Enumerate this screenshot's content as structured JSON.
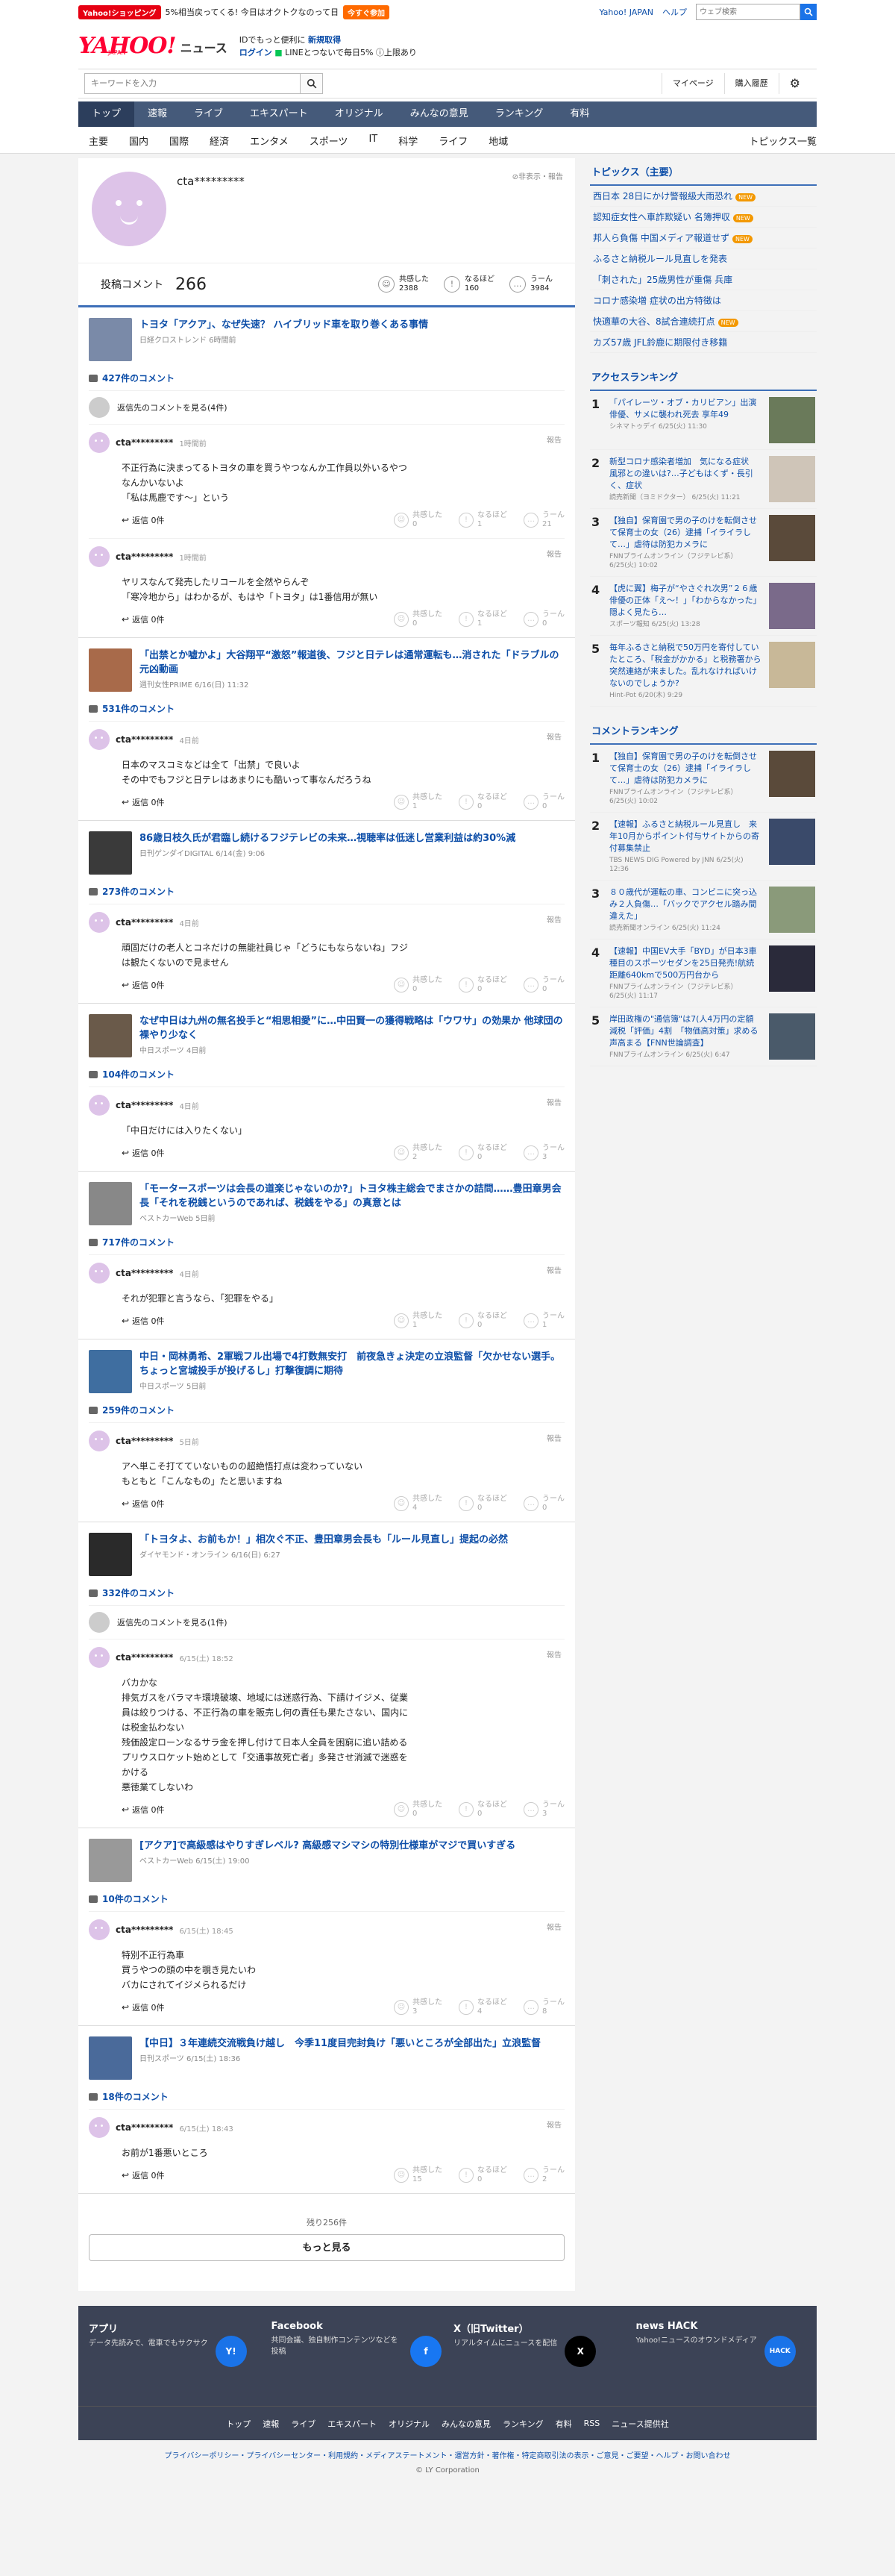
{
  "header": {
    "shop_tag": "Yahoo!ショッピング",
    "shop_promo": "5%相当戻ってくる! 今日はオクトクなのって日",
    "shop_btn": "今すぐ参加",
    "yahoo_japan": "Yahoo! JAPAN",
    "help": "ヘルプ",
    "web_search_placeholder": "ウェブ検索",
    "logo_yahoo": "YAHOO!",
    "logo_japan": "JAPAN",
    "logo_news": "ニュース",
    "promo_line1_a": "IDでもっと便利に",
    "promo_line1_b": "新規取得",
    "promo_line2_a": "ログイン",
    "promo_line2_b": "LINEとつないで毎日5%",
    "promo_line2_c": "上限あり",
    "news_search_placeholder": "キーワードを入力",
    "mypage": "マイページ",
    "purchase": "購入履歴"
  },
  "gnav": [
    "トップ",
    "速報",
    "ライブ",
    "エキスパート",
    "オリジナル",
    "みんなの意見",
    "ランキング",
    "有料"
  ],
  "snav": {
    "items": [
      "主要",
      "国内",
      "国際",
      "経済",
      "エンタメ",
      "スポーツ",
      "IT",
      "科学",
      "ライフ",
      "地域"
    ],
    "all": "トピックス一覧"
  },
  "profile": {
    "name": "cta*********",
    "privacy": "非表示・報告",
    "comments_label": "投稿コメント",
    "comments_count": "266",
    "reactions": [
      {
        "label": "共感した",
        "count": "2388",
        "icon": "☺"
      },
      {
        "label": "なるほど",
        "count": "160",
        "icon": "!"
      },
      {
        "label": "うーん",
        "count": "3984",
        "icon": "…"
      }
    ]
  },
  "articles": [
    {
      "title": "トヨタ「アクア」、なぜ失速？ ハイブリッド車を取り巻くある事情",
      "source": "日経クロストレンド 6時間前",
      "thumb": "#7a8aa8",
      "count": "427件のコメント",
      "reply_note": "返信先のコメントを見る(4件)",
      "comments": [
        {
          "user": "cta*********",
          "time": "1時間前",
          "text": "不正行為に決まってるトヨタの車を買うやつなんか工作員以外いるやつなんかいないよ\n「私は馬鹿です～」という",
          "votes": [
            "0",
            "1",
            "21"
          ]
        },
        {
          "user": "cta*********",
          "time": "1時間前",
          "text": "ヤリスなんて発売したリコールを全然やらんぞ\n「寒冷地から」はわかるが、もはや「トヨタ」は1番信用が無い",
          "votes": [
            "0",
            "1",
            "0"
          ]
        }
      ]
    },
    {
      "title": "「出禁とか嘘かよ」大谷翔平“激怒”報道後、フジと日テレは通常運転も…消された「ドラブルの元凶動画",
      "source": "週刊女性PRIME 6/16(日) 11:32",
      "thumb": "#a86a4a",
      "count": "531件のコメント",
      "reply_note": "",
      "comments": [
        {
          "user": "cta*********",
          "time": "4日前",
          "text": "日本のマスコミなどは全て「出禁」で良いよ\nその中でもフジと日テレはあまりにも酷いって事なんだろうね",
          "votes": [
            "1",
            "0",
            "0"
          ]
        }
      ]
    },
    {
      "title": "86歳日枝久氏が君臨し続けるフジテレビの未来…視聴率は低迷し営業利益は約30%減",
      "source": "日刊ゲンダイDIGITAL 6/14(金) 9:06",
      "thumb": "#3a3a3a",
      "count": "273件のコメント",
      "reply_note": "",
      "comments": [
        {
          "user": "cta*********",
          "time": "4日前",
          "text": "頑固だけの老人とコネだけの無能社員じゃ「どうにもならないね」フジは観たくないので見ません",
          "votes": [
            "0",
            "0",
            "0"
          ]
        }
      ]
    },
    {
      "title": "なぜ中日は九州の無名投手と“相思相愛”に…中田賢一の獲得戦略は「ウワサ」の効果か 他球団の裸やり少なく",
      "source": "中日スポーツ 4日前",
      "thumb": "#6a5a4a",
      "count": "104件のコメント",
      "reply_note": "",
      "comments": [
        {
          "user": "cta*********",
          "time": "4日前",
          "text": "「中日だけには入りたくない」",
          "votes": [
            "2",
            "0",
            "3"
          ]
        }
      ]
    },
    {
      "title": "「モータースポーツは会長の道楽じゃないのか?」トヨタ株主総会でまさかの詰問……豊田章男会長「それを税銭というのであれば、税銭をやる」の真意とは",
      "source": "ベストカーWeb 5日前",
      "thumb": "#888",
      "count": "717件のコメント",
      "reply_note": "",
      "comments": [
        {
          "user": "cta*********",
          "time": "4日前",
          "text": "それが犯罪と言うなら、「犯罪をやる」",
          "votes": [
            "1",
            "0",
            "1"
          ]
        }
      ]
    },
    {
      "title": "中日・岡林勇希、2軍戦フル出場で4打数無安打　前夜急きょ決定の立浪監督「欠かせない選手。ちょっと宮城投手が投げるし」打撃復調に期待",
      "source": "中日スポーツ 5日前",
      "thumb": "#3f6ea0",
      "count": "259件のコメント",
      "reply_note": "",
      "comments": [
        {
          "user": "cta*********",
          "time": "5日前",
          "text": "アヘ単こそ打てていないものの超絶悟打点は変わっていない\nもともと「こんなもの」たと思いますね",
          "votes": [
            "4",
            "0",
            "0"
          ]
        }
      ]
    },
    {
      "title": "「トヨタよ、お前もか！」相次ぐ不正、豊田章男会長も「ルール見直し」提起の必然",
      "source": "ダイヤモンド・オンライン 6/16(日) 6:27",
      "thumb": "#2a2a2a",
      "count": "332件のコメント",
      "reply_note": "返信先のコメントを見る(1件)",
      "comments": [
        {
          "user": "cta*********",
          "time": "6/15(土) 18:52",
          "text": "バカかな\n排気ガスをバラマキ環境破壊、地域には迷惑行為、下請けイジメ、従業員は絞りつける、不正行為の車を販売し何の責任も果たさない、国内には税金払わない\n残価設定ローンなるサラ金を押し付けて日本人全員を困窮に追い詰める\nプリウスロケット始めとして「交通事故死亡者」多発させ消滅で迷惑をかける\n悪徳業てしないわ",
          "votes": [
            "0",
            "0",
            "3"
          ]
        }
      ]
    },
    {
      "title": "[アクア]で高級感はやりすぎレベル? 高級感マシマシの特別仕様車がマジで買いすぎる",
      "source": "ベストカーWeb 6/15(土) 19:00",
      "thumb": "#999",
      "count": "10件のコメント",
      "reply_note": "",
      "comments": [
        {
          "user": "cta*********",
          "time": "6/15(土) 18:45",
          "text": "特別不正行為車\n買うやつの頭の中を覗き見たいわ\nバカにされてイジメられるだけ",
          "votes": [
            "3",
            "4",
            "8"
          ]
        }
      ]
    },
    {
      "title": "【中日】３年連続交流戦負け越し　今季11度目完封負け「悪いところが全部出た」立浪監督",
      "source": "日刊スポーツ 6/15(土) 18:36",
      "thumb": "#4a6a9a",
      "count": "18件のコメント",
      "reply_note": "",
      "comments": [
        {
          "user": "cta*********",
          "time": "6/15(土) 18:43",
          "text": "お前が1番悪いところ",
          "votes": [
            "15",
            "0",
            "2"
          ]
        }
      ]
    }
  ],
  "comment_ui": {
    "report": "報告",
    "reply": "返信 0件",
    "vote_labels": [
      "共感した",
      "なるほど",
      "うーん"
    ]
  },
  "more": {
    "remain": "残り256件",
    "button": "もっと見る"
  },
  "topics": {
    "title": "トピックス（主要）",
    "items": [
      {
        "text": "西日本 28日にかけ警報級大雨恐れ",
        "new": true
      },
      {
        "text": "認知症女性へ車詐欺疑い 名簿押収",
        "new": true
      },
      {
        "text": "邦人ら負傷 中国メディア報道せず",
        "new": true
      },
      {
        "text": "ふるさと納税ルール見直しを発表",
        "new": false
      },
      {
        "text": "「刺された」25歳男性が重傷 兵庫",
        "new": false
      },
      {
        "text": "コロナ感染増 症状の出方特徴は",
        "new": false
      },
      {
        "text": "快適華の大谷、8試合連続打点",
        "new": true
      },
      {
        "text": "カズ57歳 JFL鈴鹿に期限付き移籍",
        "new": false
      }
    ],
    "new_label": "NEW"
  },
  "access_ranking": {
    "title": "アクセスランキング",
    "items": [
      {
        "n": "1",
        "t": "「パイレーツ・オブ・カリビアン」出演俳優、サメに襲われ死去 享年49",
        "s": "シネマトゥデイ 6/25(火) 11:30",
        "c": "#6a7a5a"
      },
      {
        "n": "2",
        "t": "新型コロナ感染者増加　気になる症状　風邪との違いは?…子どもはくず・長引く、症状",
        "s": "読売新聞（ヨミドクター） 6/25(火) 11:21",
        "c": "#cfc5b8"
      },
      {
        "n": "3",
        "t": "【独自】保育園で男の子のけを転倒させて保育士の女（26）逮捕「イライラして…」虐待は防犯カメラに",
        "s": "FNNプライムオンライン（フジテレビ系） 6/25(火) 10:02",
        "c": "#5a4a3a"
      },
      {
        "n": "4",
        "t": "【虎に翼】梅子が“やさぐれ次男”２６歳俳優の正体「え～！」「わからなかった」隠よく見たら…",
        "s": "スポーツ報知 6/25(火) 13:28",
        "c": "#7a6a8a"
      },
      {
        "n": "5",
        "t": "毎年ふるさと納税で50万円を寄付していたところ、「税金がかかる」と税務署から突然連絡が来ました。乱れなければいけないのでしょうか?",
        "s": "Hint-Pot 6/20(木) 9:29",
        "c": "#c8b898"
      }
    ]
  },
  "comment_ranking": {
    "title": "コメントランキング",
    "items": [
      {
        "n": "1",
        "t": "【独自】保育園で男の子のけを転倒させて保育士の女（26）逮捕「イライラして…」虐待は防犯カメラに",
        "s": "FNNプライムオンライン（フジテレビ系） 6/25(火) 10:02",
        "c": "#5a4a3a"
      },
      {
        "n": "2",
        "t": "【速報】ふるさと納税ルール見直し　来年10月からポイント付与サイトからの寄付募集禁止",
        "s": "TBS NEWS DIG Powered by JNN 6/25(火) 12:36",
        "c": "#3a4a6a"
      },
      {
        "n": "3",
        "t": "８０歳代が運転の車、コンビニに突っ込み２人負傷…「バックでアクセル踏み間違えた」",
        "s": "読売新聞オンライン 6/25(火) 11:24",
        "c": "#8a9a7a"
      },
      {
        "n": "4",
        "t": "【速報】中国EV大手「BYD」が日本3車種目のスポーツセダンを25日発売!航続距離640kmで500万円台から",
        "s": "FNNプライムオンライン（フジテレビ系） 6/25(火) 11:17",
        "c": "#2a2a3a"
      },
      {
        "n": "5",
        "t": "岸田政権の\"通信簿\"は7(人4万円の定額減税「評価」4割　「物価高対策」求める声高まる【FNN世論調査】",
        "s": "FNNプライムオンライン 6/25(火) 6:47",
        "c": "#4a5a6a"
      }
    ]
  },
  "footer": {
    "apps": [
      {
        "title": "アプリ",
        "desc": "データ先読みで、電車でもサクサク",
        "icon": "Y!",
        "color": "#1a73e8"
      },
      {
        "title": "Facebook",
        "desc": "共同会議、独自制作コンテンツなどを投稿",
        "icon": "f",
        "color": "#1877f2"
      },
      {
        "title": "X（旧Twitter）",
        "desc": "リアルタイムにニュースを配信",
        "icon": "X",
        "color": "#000"
      },
      {
        "title": "news HACK",
        "desc": "Yahoo!ニュースのオウンドメディア",
        "icon": "HACK",
        "color": "#1a73e8"
      }
    ],
    "nav": [
      "トップ",
      "速報",
      "ライブ",
      "エキスパート",
      "オリジナル",
      "みんなの意見",
      "ランキング",
      "有料",
      "RSS",
      "ニュース提供社"
    ],
    "links": "プライバシーポリシー・プライバシーセンター・利用規約・メディアステートメント・運営方針・著作権・特定商取引法の表示・ご意見・ご要望・ヘルプ・お問い合わせ",
    "copyright": "© LY Corporation"
  }
}
